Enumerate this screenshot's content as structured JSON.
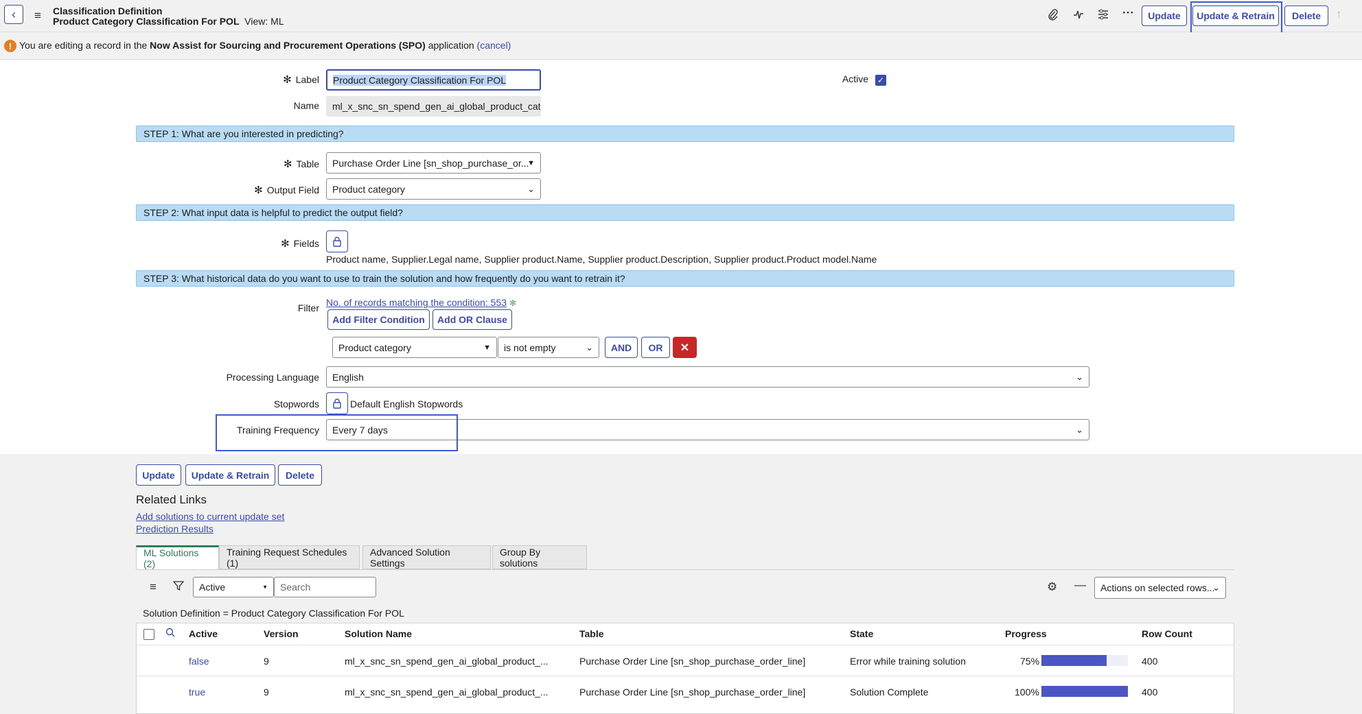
{
  "header": {
    "record_type": "Classification Definition",
    "record_name": "Product Category Classification For POL",
    "view": "View: ML",
    "buttons": {
      "update": "Update",
      "update_retrain": "Update & Retrain",
      "delete": "Delete"
    },
    "icons": [
      "back-icon",
      "hamburger-menu-icon",
      "paperclip-icon",
      "activity-icon",
      "settings-sliders-icon",
      "more-icon",
      "arrow-up-icon"
    ]
  },
  "banner": {
    "prefix": "You are editing a record in the",
    "app_name": "Now Assist for Sourcing and Procurement Operations (SPO)",
    "suffix": "application",
    "cancel": "(cancel)"
  },
  "form": {
    "label_label": "Label",
    "label_value": "Product Category Classification For POL",
    "active_label": "Active",
    "active_checked": true,
    "name_label": "Name",
    "name_value": "ml_x_snc_sn_spend_gen_ai_global_product_catego",
    "step1": "STEP 1: What are you interested in predicting?",
    "table_label": "Table",
    "table_value": "Purchase Order Line [sn_shop_purchase_or...",
    "output_field_label": "Output Field",
    "output_field_value": "Product category",
    "step2": "STEP 2: What input data is helpful to predict the output field?",
    "fields_label": "Fields",
    "fields_value": "Product name, Supplier.Legal name, Supplier product.Name, Supplier product.Description, Supplier product.Product model.Name",
    "step3": "STEP 3: What historical data do you want to use to train the solution and how frequently do you want to retrain it?",
    "filter_label": "Filter",
    "filter_count_link": "No. of records matching the condition: 553",
    "add_filter_condition": "Add Filter Condition",
    "add_or_clause": "Add OR Clause",
    "condition_field": "Product category",
    "condition_operator": "is not empty",
    "and_button": "AND",
    "or_button": "OR",
    "processing_language_label": "Processing Language",
    "processing_language_value": "English",
    "stopwords_label": "Stopwords",
    "stopwords_value": "Default English Stopwords",
    "training_frequency_label": "Training Frequency",
    "training_frequency_value": "Every 7 days"
  },
  "bottom_buttons": {
    "update": "Update",
    "update_retrain": "Update & Retrain",
    "delete": "Delete"
  },
  "related_links": {
    "title": "Related Links",
    "links": [
      "Add solutions to current update set",
      "Prediction Results"
    ]
  },
  "tabs": [
    {
      "label": "ML Solutions (2)",
      "active": true
    },
    {
      "label": "Training Request Schedules (1)",
      "active": false
    },
    {
      "label": "Advanced Solution Settings",
      "active": false
    },
    {
      "label": "Group By solutions",
      "active": false
    }
  ],
  "list": {
    "filter_select": "Active",
    "search_placeholder": "Search",
    "actions_select": "Actions on selected rows...",
    "breadcrumb": "Solution Definition = Product Category Classification For POL",
    "columns": [
      "Active",
      "Version",
      "Solution Name",
      "Table",
      "State",
      "Progress",
      "Row Count"
    ],
    "rows": [
      {
        "active": "false",
        "version": "9",
        "solution_name": "ml_x_snc_sn_spend_gen_ai_global_product_...",
        "table": "Purchase Order Line [sn_shop_purchase_order_line]",
        "state": "Error while training solution",
        "progress_label": "75%",
        "progress": 0.75,
        "row_count": "400"
      },
      {
        "active": "true",
        "version": "9",
        "solution_name": "ml_x_snc_sn_spend_gen_ai_global_product_...",
        "table": "Purchase Order Line [sn_shop_purchase_order_line]",
        "state": "Solution Complete",
        "progress_label": "100%",
        "progress": 1.0,
        "row_count": "400"
      }
    ]
  },
  "colors": {
    "accent": "#3a4bb0",
    "step_bg": "#b9dbf3",
    "delete_red": "#c62828",
    "progress": "#4b55c3",
    "tab_active": "#2e7d5b",
    "warning": "#e67e22"
  }
}
